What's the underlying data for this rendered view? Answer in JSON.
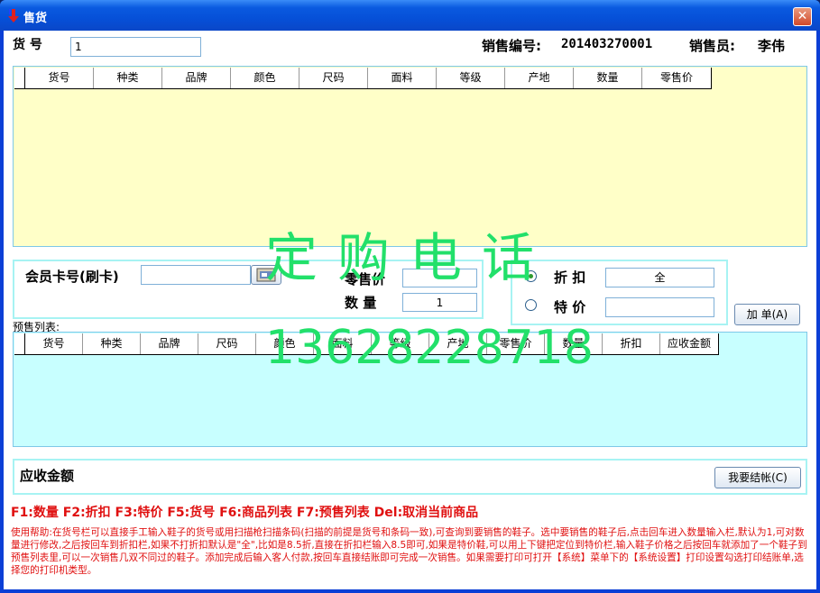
{
  "window": {
    "title": "售货",
    "close": "✕"
  },
  "top": {
    "item_no_label": "货 号",
    "item_no_value": "1",
    "sale_no_label": "销售编号:",
    "sale_no_value": "201403270001",
    "seller_label": "销售员:",
    "seller_value": "李伟"
  },
  "grid1": {
    "columns": [
      "货号",
      "种类",
      "品牌",
      "颜色",
      "尺码",
      "面料",
      "等级",
      "产地",
      "数量",
      "零售价"
    ]
  },
  "member": {
    "card_label": "会员卡号(刷卡)",
    "card_value": "",
    "retail_price_label": "零售价",
    "retail_price_value": "",
    "qty_label": "数 量",
    "qty_value": "1"
  },
  "discount": {
    "discount_label": "折 扣",
    "discount_value": "全",
    "special_label": "特 价",
    "special_value": "",
    "selected": "discount"
  },
  "buttons": {
    "add": "加 单(A)",
    "checkout": "我要结帐(C)"
  },
  "presale": {
    "label": "预售列表:",
    "columns": [
      "货号",
      "种类",
      "品牌",
      "尺码",
      "颜色",
      "面料",
      "等级",
      "产地",
      "零售价",
      "数量",
      "折扣",
      "应收金额"
    ]
  },
  "receivable": {
    "label": "应收金额"
  },
  "watermark": {
    "line1": "定购电话",
    "line2": "13628228718"
  },
  "hotkeys": "F1:数量 F2:折扣 F3:特价 F5:货号 F6:商品列表 F7:预售列表 Del:取消当前商品",
  "help": "使用帮助:在货号栏可以直接手工输入鞋子的货号或用扫描枪扫描条码(扫描的前提是货号和条码一致),可查询到要销售的鞋子。选中要销售的鞋子后,点击回车进入数量输入栏,默认为1,可对数量进行修改,之后按回车到折扣栏,如果不打折扣默认是\"全\",比如是8.5折,直接在折扣栏输入8.5即可,如果是特价鞋,可以用上下键把定位到特价栏,输入鞋子价格之后按回车就添加了一个鞋子到预售列表里,可以一次销售几双不同过的鞋子。添加完成后输入客人付款,按回车直接结账即可完成一次销售。如果需要打印可打开【系统】菜单下的【系统设置】打印设置勾选打印结账单,选择您的打印机类型。",
  "colors": {
    "accent": "#0b3fd6",
    "grid1_bg": "#ffffc8",
    "grid2_bg": "#c8ffff",
    "help_text": "#e01010",
    "watermark": "#22e06a"
  }
}
